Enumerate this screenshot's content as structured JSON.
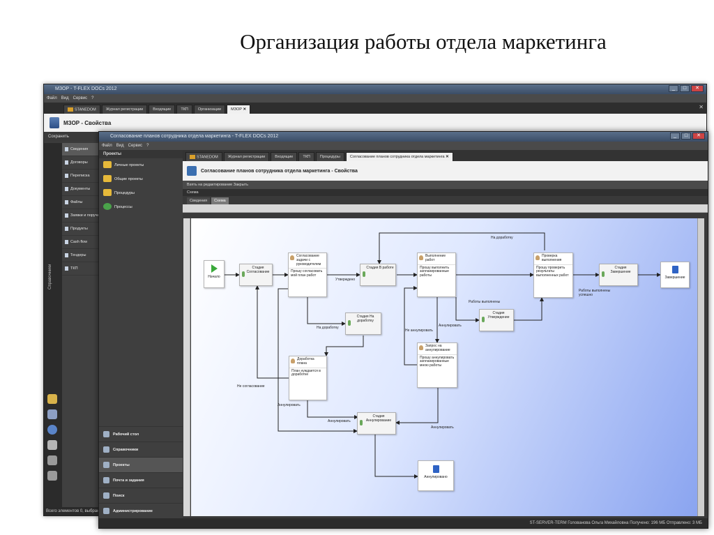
{
  "slide": {
    "title": "Организация работы отдела маркетинга"
  },
  "win1": {
    "title": "МЗОР - T-FLEX DOCs 2012",
    "menu": [
      "Файл",
      "Вид",
      "Сервис",
      "?"
    ],
    "tabs": [
      "STANEDOM",
      "Журнал регистрации",
      "Входящие",
      "ТКП",
      "Организации",
      "МЗОР"
    ],
    "header": "МЗОР - Свойства",
    "toolbar_save": "Сохранить",
    "side_items": [
      "Сведения",
      "Договоры",
      "Переписка",
      "Документы",
      "Файлы",
      "Заявки и поручения",
      "Продукты",
      "Cash flow",
      "Тендеры",
      "ТКП"
    ],
    "nav_vertical": "Справочники",
    "status": "Всего элементов 0, выбрано"
  },
  "win2": {
    "title": "Согласование планов сотрудника отдела маркетинга - T-FLEX DOCs 2012",
    "menu": [
      "Файл",
      "Вид",
      "Сервис",
      "?"
    ],
    "nav_head": "Проекты",
    "projects": [
      "Личные проекты",
      "Общие проекты",
      "Процедуры",
      "Процессы"
    ],
    "bottom_nav": [
      "Рабочий стол",
      "Справочники",
      "Проекты",
      "Почта и задания",
      "Поиск",
      "Администрирование"
    ],
    "tabs": [
      "STANEDOM",
      "Журнал регистрации",
      "Входящие",
      "ТКП",
      "Процедуры",
      "Согласование планов сотрудника отдела маркетинга"
    ],
    "header": "Согласование планов сотрудника отдела маркетинга - Свойства",
    "tool": "Взять на редактирование     Закрыть",
    "schema_label": "Схема",
    "subtabs": [
      "Сведения",
      "Схема"
    ],
    "status": "ST-SERVER-TERM    Голованова Ольга Михайловна    Получено: 196 МБ    Отправлено: 3 МБ"
  },
  "diagram": {
    "start": "Начало",
    "stage_agree": "Стадия Согласование",
    "agree_task_title": "Согласование задачи с руководителем",
    "agree_task_body": "Прошу согласовать мой план работ",
    "stage_work": "Стадия В работе",
    "exec_title": "Выполнение работ",
    "exec_body": "Прошу выполнить запланированные работы",
    "check_title": "Проверка выполнения",
    "check_body": "Прошу проверить результаты выполненных работ",
    "stage_done": "Стадия Завершение",
    "end": "Завершение",
    "stage_rework": "Стадия На доработку",
    "stage_approve": "Стадия Утверждение",
    "rework_title": "Доработка плана",
    "rework_body": "План нуждается в доработке",
    "cancel_req_title": "Запрос на аннулирование",
    "cancel_req_body": "Прошу аннулировать запланированные мною работы",
    "stage_cancel": "Стадия Аннулирование",
    "canceled": "Аннулировано",
    "l_rework_top": "На доработку",
    "l_approved": "Утверждено",
    "l_rework": "На доработку",
    "l_not_agree": "Не согласование",
    "l_annul1": "Аннулировать",
    "l_annul2": "Аннулировать",
    "l_annul3": "Аннулировать",
    "l_annul4": "Аннулировать",
    "l_not_annul": "Не аннулировать",
    "l_work_done": "Работы выполнены",
    "l_success": "Работы выполнены успешно"
  }
}
